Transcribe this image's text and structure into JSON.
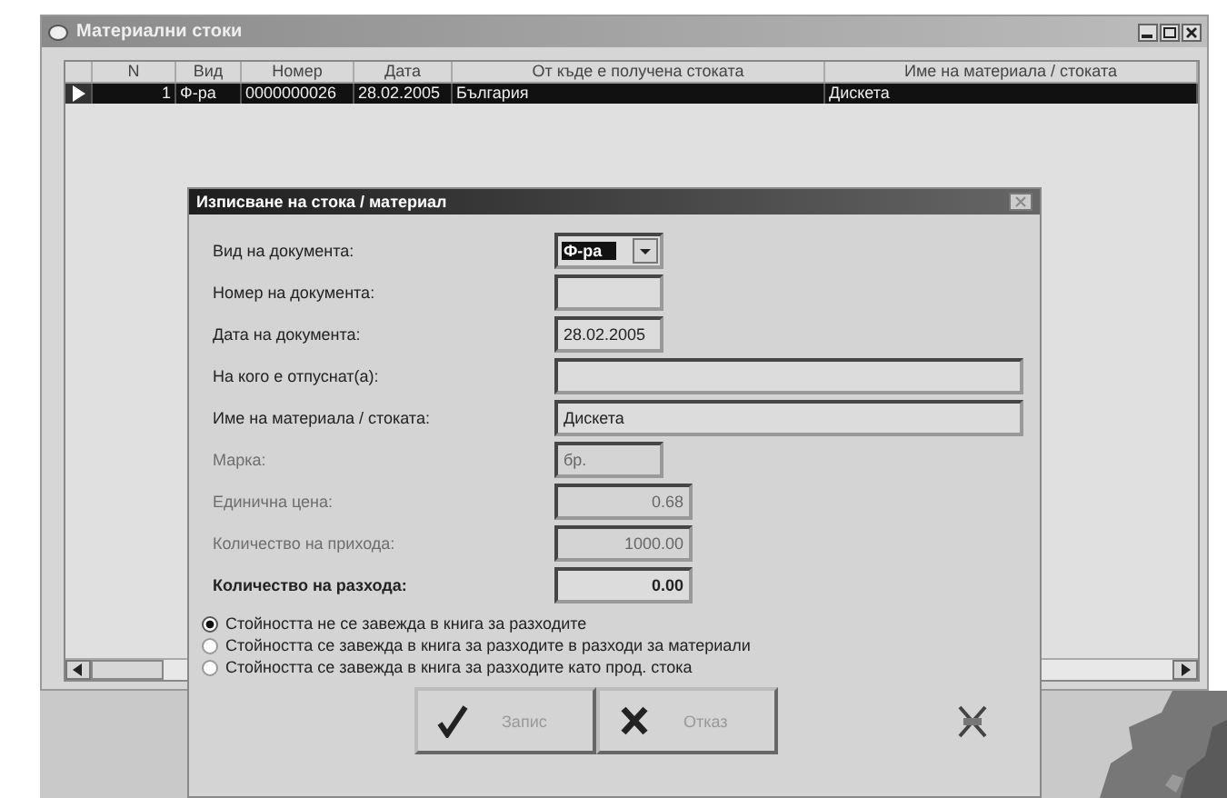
{
  "window": {
    "title": "Материални стоки"
  },
  "table": {
    "columns": [
      "N",
      "Вид",
      "Номер",
      "Дата",
      "От къде е получена стоката",
      "Име на материала / стоката"
    ],
    "rows": [
      {
        "selected": true,
        "cells": [
          "1",
          "Ф-ра",
          "0000000026",
          "28.02.2005",
          "България",
          "Дискета"
        ]
      }
    ]
  },
  "dialog": {
    "title": "Изписване на стока / материал",
    "fields": [
      {
        "label": "Вид на документа:",
        "value": "Ф-ра",
        "kind": "combo",
        "disabled": false,
        "bold": false
      },
      {
        "label": "Номер на документа:",
        "kind": "short",
        "disabled": false,
        "bold": false
      },
      {
        "label": "Дата на документа:",
        "value": "28.02.2005",
        "kind": "short",
        "disabled": false,
        "bold": false
      },
      {
        "label": "На кого е отпуснат(а):",
        "kind": "long",
        "disabled": false,
        "bold": false
      },
      {
        "label": "Име на материала / стоката:",
        "value": "Дискета",
        "kind": "long",
        "disabled": false,
        "bold": false
      },
      {
        "label": "Марка:",
        "value": "бр.",
        "kind": "short",
        "disabled": true,
        "bold": false
      },
      {
        "label": "Единична цена:",
        "value": "0.68",
        "kind": "number",
        "disabled": true,
        "bold": false
      },
      {
        "label": "Количество на прихода:",
        "value": "1000.00",
        "kind": "number",
        "disabled": true,
        "bold": false
      },
      {
        "label": "Количество на разхода:",
        "value": "0.00",
        "kind": "number",
        "disabled": false,
        "bold": true
      }
    ],
    "options": [
      {
        "label": "Стойността не се завежда в книга за разходите",
        "selected": true
      },
      {
        "label": "Стойността се завежда в книга за разходите в разходи за материали",
        "selected": false
      },
      {
        "label": "Стойността се завежда в книга за разходите като прод. стока",
        "selected": false
      }
    ],
    "buttons": [
      {
        "label": "Запис",
        "kind": "save"
      },
      {
        "label": "Отказ",
        "kind": "cancel"
      }
    ]
  }
}
